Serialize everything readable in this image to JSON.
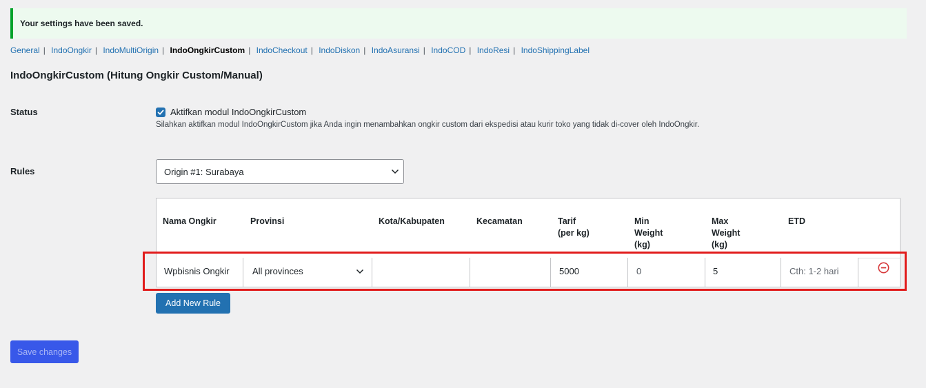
{
  "notice": {
    "text": "Your settings have been saved."
  },
  "nav": {
    "items": [
      {
        "label": "General",
        "current": false
      },
      {
        "label": "IndoOngkir",
        "current": false
      },
      {
        "label": "IndoMultiOrigin",
        "current": false
      },
      {
        "label": "IndoOngkirCustom",
        "current": true
      },
      {
        "label": "IndoCheckout",
        "current": false
      },
      {
        "label": "IndoDiskon",
        "current": false
      },
      {
        "label": "IndoAsuransi",
        "current": false
      },
      {
        "label": "IndoCOD",
        "current": false
      },
      {
        "label": "IndoResi",
        "current": false
      },
      {
        "label": "IndoShippingLabel",
        "current": false
      }
    ],
    "separator": "|"
  },
  "page": {
    "title": "IndoOngkirCustom (Hitung Ongkir Custom/Manual)"
  },
  "status": {
    "label": "Status",
    "checkbox_label": "Aktifkan modul IndoOngkirCustom",
    "checked": true,
    "description": "Silahkan aktifkan modul IndoOngkirCustom jika Anda ingin menambahkan ongkir custom dari ekspedisi atau kurir toko yang tidak di-cover oleh IndoOngkir."
  },
  "rules": {
    "label": "Rules",
    "origin_selected": "Origin #1: Surabaya",
    "columns": {
      "nama": "Nama Ongkir",
      "provinsi": "Provinsi",
      "kota": "Kota/Kabupaten",
      "kecamatan": "Kecamatan",
      "tarif": "Tarif\n(per kg)",
      "min_weight": "Min\nWeight\n(kg)",
      "max_weight": "Max\nWeight\n(kg)",
      "etd": "ETD"
    },
    "row": {
      "nama": "Wpbisnis Ongkir",
      "provinsi": "All provinces",
      "kota": "",
      "kecamatan": "",
      "tarif": "5000",
      "min_weight": "0",
      "max_weight": "5",
      "etd_placeholder": "Cth: 1-2 hari"
    },
    "add_button": "Add New Rule"
  },
  "save_button": "Save changes",
  "colors": {
    "accent": "#2271b1",
    "success": "#00a32a",
    "highlight": "#e11b1b",
    "remove": "#d63638",
    "save_button": "#3858e9"
  },
  "icons": {
    "checkbox": "checkmark-icon",
    "dropdown": "chevron-down-icon",
    "remove": "minus-circle-icon"
  }
}
